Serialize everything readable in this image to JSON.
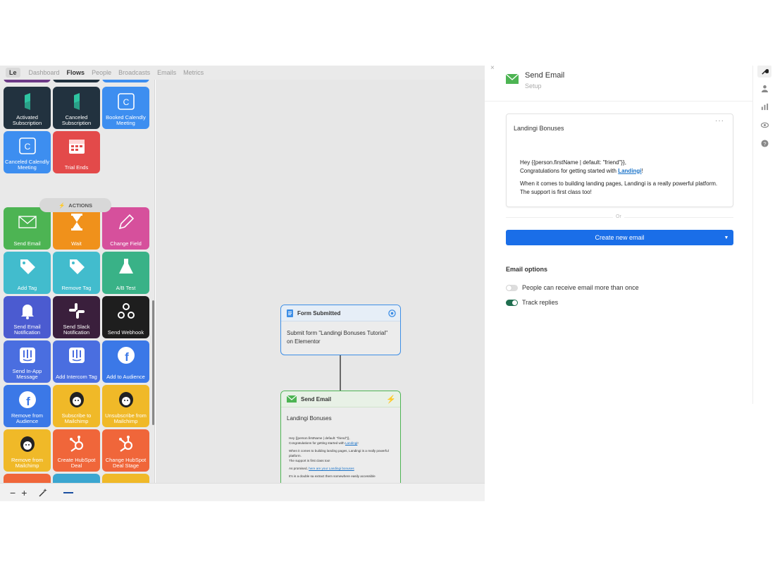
{
  "topnav": {
    "logo": "Le",
    "items": [
      "Dashboard",
      "Flows",
      "People",
      "Broadcasts",
      "Emails",
      "Metrics"
    ],
    "active": "Flows"
  },
  "palette": {
    "triggers": [
      {
        "label": "Activated Subscription",
        "color": "#22323f",
        "icon": "stripe-icon"
      },
      {
        "label": "Canceled Subscription",
        "color": "#22323f",
        "icon": "stripe-icon"
      },
      {
        "label": "Booked Calendly Meeting",
        "color": "#3d8ef0",
        "icon": "calendly-icon"
      },
      {
        "label": "Canceled Calendly Meeting",
        "color": "#3d8ef0",
        "icon": "calendly-icon"
      },
      {
        "label": "Trial Ends",
        "color": "#e34a4a",
        "icon": "calendar-icon"
      }
    ],
    "actions_label": "ACTIONS",
    "actions": [
      {
        "label": "Send Email",
        "color": "#4db453",
        "icon": "envelope-icon"
      },
      {
        "label": "Wait",
        "color": "#f0911b",
        "icon": "hourglass-icon"
      },
      {
        "label": "Change Field",
        "color": "#d6509c",
        "icon": "pencil-icon"
      },
      {
        "label": "Add Tag",
        "color": "#42bccd",
        "icon": "tag-icon"
      },
      {
        "label": "Remove Tag",
        "color": "#42bccd",
        "icon": "tag-icon"
      },
      {
        "label": "A/B Test",
        "color": "#39b287",
        "icon": "flask-icon"
      },
      {
        "label": "Send Email Notification",
        "color": "#4b5bd0",
        "icon": "bell-icon"
      },
      {
        "label": "Send Slack Notification",
        "color": "#3a1f3c",
        "icon": "slack-icon"
      },
      {
        "label": "Send Webhook",
        "color": "#1e1e1e",
        "icon": "webhook-icon"
      },
      {
        "label": "Send In-App Message",
        "color": "#4a6ee0",
        "icon": "intercom-icon"
      },
      {
        "label": "Add Intercom Tag",
        "color": "#4a6ee0",
        "icon": "intercom-icon"
      },
      {
        "label": "Add to Audience",
        "color": "#3b78e7",
        "icon": "facebook-icon"
      },
      {
        "label": "Remove from Audience",
        "color": "#3b78e7",
        "icon": "facebook-icon"
      },
      {
        "label": "Subscribe to Mailchimp",
        "color": "#f0b928",
        "icon": "mailchimp-icon"
      },
      {
        "label": "Unsubscribe from Mailchimp",
        "color": "#f0b928",
        "icon": "mailchimp-icon"
      },
      {
        "label": "Remove from Mailchimp",
        "color": "#f0b928",
        "icon": "mailchimp-icon"
      },
      {
        "label": "Create HubSpot Deal",
        "color": "#f0663a",
        "icon": "hubspot-icon"
      },
      {
        "label": "Change HubSpot Deal Stage",
        "color": "#f0663a",
        "icon": "hubspot-icon"
      }
    ]
  },
  "canvas": {
    "node1": {
      "title": "Form Submitted",
      "body": "Submit form \"Landingi Bonuses Tutorial\" on Elementor"
    },
    "node2": {
      "title": "Send Email",
      "subject": "Landingi Bonuses",
      "line1": "Hey {{person.firstName | default: \"friend\"}},",
      "line2": "Congratulations for getting started with",
      "link": "Landingi",
      "line3": "When it comes to building landing pages, Landingi is a really powerful platform.",
      "line4": "The support is first class too!",
      "line5a": "As promised,",
      "line5link": "here are your Landingi bonuses",
      "line6": "It's is a double sa extract them somewhere easily accessible"
    }
  },
  "toolbar": {
    "zoom_out": "−",
    "zoom_in": "+"
  },
  "panel": {
    "close": "×",
    "title": "Send Email",
    "subtitle": "Setup",
    "email": {
      "subject": "Landingi Bonuses",
      "menu": "···",
      "line1": "Hey {{person.firstName | default: \"friend\"}},",
      "line2": "Congratulations for getting started with",
      "link": "Landingi",
      "line2end": "!",
      "line3": "When it comes to building landing pages, Landingi is a really powerful platform.",
      "line4": "The support is first class too!"
    },
    "or": "Or",
    "create": "Create new email",
    "options_title": "Email options",
    "opt1": "People can receive email more than once",
    "opt1_on": false,
    "opt2": "Track replies",
    "opt2_on": true
  },
  "colors": {
    "primary": "#1a6ee8",
    "trigger_border": "#3d8ee6",
    "action_border": "#4db453",
    "toggle_on": "#1f6e4f"
  }
}
